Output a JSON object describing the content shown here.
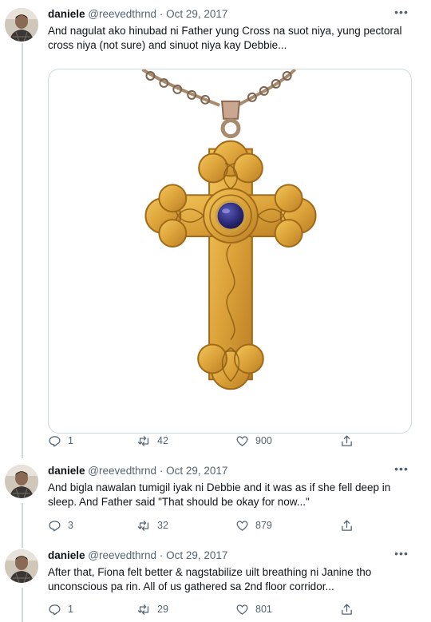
{
  "tweets": [
    {
      "name": "daniele",
      "handle": "@reevedthrnd",
      "separator": "·",
      "date": "Oct 29, 2017",
      "text_lines": [
        "And nagulat ako hinubad ni Father yung Cross na suot niya, yung pectoral",
        "cross niya (not sure) and sinuot niya kay Debbie..."
      ],
      "has_media": true,
      "replies": "1",
      "retweets": "42",
      "likes": "900"
    },
    {
      "name": "daniele",
      "handle": "@reevedthrnd",
      "separator": "·",
      "date": "Oct 29, 2017",
      "text_lines": [
        "And bigla nawalan tumigil iyak ni Debbie and it was as if she fell deep in",
        "sleep. And Father said \"That should be okay for now...\""
      ],
      "has_media": false,
      "replies": "3",
      "retweets": "32",
      "likes": "879"
    },
    {
      "name": "daniele",
      "handle": "@reevedthrnd",
      "separator": "·",
      "date": "Oct 29, 2017",
      "text_lines": [
        "After that, Fiona felt better & nagstabilize uilt breathing ni Janine tho",
        "unconscious pa rin. All of us gathered sa 2nd floor corridor..."
      ],
      "has_media": false,
      "replies": "1",
      "retweets": "29",
      "likes": "801"
    }
  ],
  "icons": {
    "more": "more-icon",
    "reply": "reply-icon",
    "retweet": "retweet-icon",
    "like": "heart-icon",
    "share": "share-icon"
  },
  "colors": {
    "text": "#0f1419",
    "muted": "#536471",
    "border": "#cfd9de",
    "gold": "#d9a23a",
    "gem": "#2b2a78"
  }
}
